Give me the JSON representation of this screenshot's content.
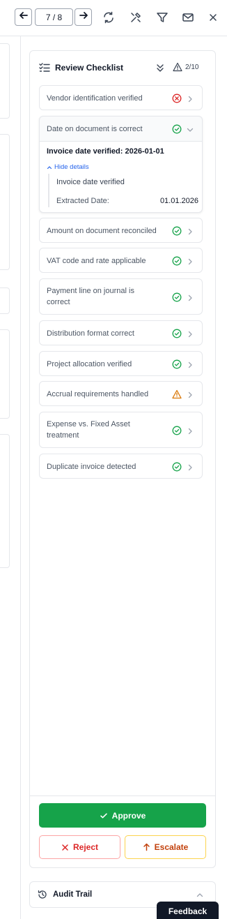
{
  "toolbar": {
    "pager": "7 / 8",
    "prev_icon": "arrow-left-icon",
    "next_icon": "arrow-right-icon",
    "refresh_icon": "refresh-icon",
    "tools_icon": "tools-icon",
    "filter_icon": "filter-icon",
    "mail_icon": "mail-icon",
    "close_icon": "close-icon"
  },
  "checklist": {
    "title": "Review Checklist",
    "count": "2/10",
    "items": [
      {
        "label": "Vendor identification verified",
        "status": "error"
      },
      {
        "label": "Date on document is correct",
        "status": "ok",
        "expanded": true
      },
      {
        "label": "Amount on document reconciled",
        "status": "ok"
      },
      {
        "label": "VAT code and rate applicable",
        "status": "ok"
      },
      {
        "label": "Payment line on journal is correct",
        "status": "ok"
      },
      {
        "label": "Distribution format correct",
        "status": "ok"
      },
      {
        "label": "Project allocation verified",
        "status": "ok"
      },
      {
        "label": "Accrual requirements handled",
        "status": "warning"
      },
      {
        "label": "Expense vs. Fixed Asset treatment",
        "status": "ok"
      },
      {
        "label": "Duplicate invoice detected",
        "status": "ok"
      }
    ],
    "expanded_detail": {
      "headline": "Invoice date verified: 2026-01-01",
      "toggle_label": "Hide details",
      "line": "Invoice date verified",
      "key": "Extracted Date:",
      "value": "01.01.2026"
    }
  },
  "actions": {
    "approve": "Approve",
    "reject": "Reject",
    "escalate": "Escalate"
  },
  "audit": {
    "title": "Audit Trail"
  },
  "feedback": "Feedback",
  "colors": {
    "ok": "#16a34a",
    "error": "#dc2626",
    "warning": "#d97706",
    "link": "#2563eb"
  }
}
